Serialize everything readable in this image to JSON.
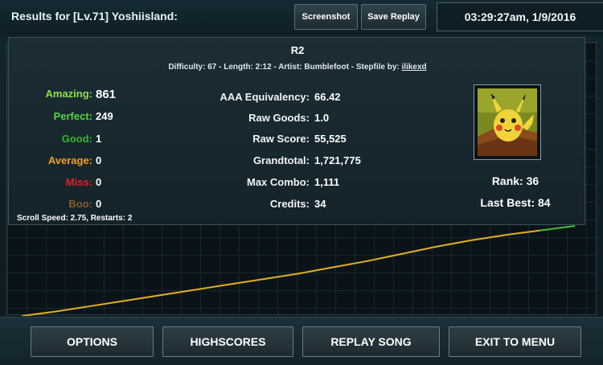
{
  "header": {
    "results_title": "Results for [Lv.71] Yoshiisland:",
    "screenshot_label": "Screenshot",
    "save_replay_label": "Save Replay",
    "datetime": "03:29:27am, 1/9/2016"
  },
  "song": {
    "title": "R2",
    "difficulty_text": "Difficulty: 67 - Length: 2:12 - Artist: Bumblefoot  -  Stepfile by:",
    "stepfile_author": "ilikexd"
  },
  "judgements": [
    {
      "label": "Amazing:",
      "value": "861",
      "color": "#8fe04b"
    },
    {
      "label": "Perfect:",
      "value": "249",
      "color": "#58d43d"
    },
    {
      "label": "Good:",
      "value": "1",
      "color": "#2fb82c"
    },
    {
      "label": "Average:",
      "value": "0",
      "color": "#f0a020"
    },
    {
      "label": "Miss:",
      "value": "0",
      "color": "#e02020"
    },
    {
      "label": "Boo:",
      "value": "0",
      "color": "#8a5a24"
    }
  ],
  "stats": [
    {
      "label": "AAA Equivalency:",
      "value": "66.42"
    },
    {
      "label": "Raw Goods:",
      "value": "1.0"
    },
    {
      "label": "Raw Score:",
      "value": "55,525"
    },
    {
      "label": "Grandtotal:",
      "value": "1,721,775"
    },
    {
      "label": "Max Combo:",
      "value": "1,111"
    },
    {
      "label": "Credits:",
      "value": "34"
    }
  ],
  "scroll_info": "Scroll Speed: 2.75, Restarts: 2",
  "rank": {
    "rank_text": "Rank: 36",
    "last_best_text": "Last Best: 84"
  },
  "avatar": {
    "icon": "pikachu-avatar-icon"
  },
  "graph": {
    "line_colors": {
      "main": "#e0b020",
      "end": "#3fc13a"
    },
    "progress": [
      0.0,
      0.05,
      0.11,
      0.17,
      0.23,
      0.29,
      0.35,
      0.41,
      0.47,
      0.54,
      0.61,
      0.69,
      0.77,
      0.84,
      0.9,
      0.95,
      1.0
    ]
  },
  "footer": {
    "options_label": "OPTIONS",
    "highscores_label": "HIGHSCORES",
    "replay_label": "REPLAY SONG",
    "exit_label": "EXIT TO MENU"
  }
}
